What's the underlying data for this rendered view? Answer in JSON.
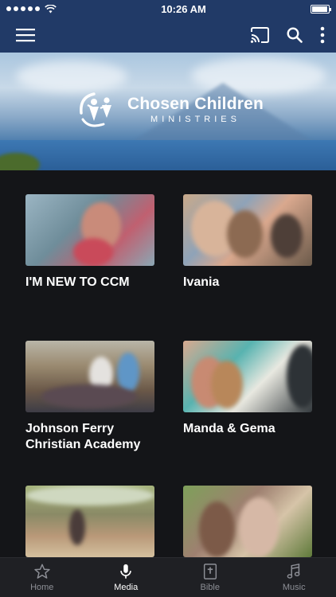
{
  "status_bar": {
    "time": "10:26 AM",
    "battery_level": 0.95
  },
  "app_bar": {
    "menu_icon": "hamburger-menu-icon",
    "cast_icon": "cast-icon",
    "search_icon": "search-icon",
    "more_icon": "more-vertical-icon"
  },
  "banner": {
    "logo_title": "Chosen Children",
    "logo_subtitle": "MINISTRIES"
  },
  "media_items": [
    {
      "title": "I'M NEW TO CCM"
    },
    {
      "title": "Ivania"
    },
    {
      "title": "Johnson Ferry Christian Academy"
    },
    {
      "title": "Manda & Gema"
    },
    {
      "title": ""
    },
    {
      "title": ""
    }
  ],
  "tab_bar": {
    "tabs": [
      {
        "label": "Home",
        "icon": "star-icon"
      },
      {
        "label": "Media",
        "icon": "microphone-icon"
      },
      {
        "label": "Bible",
        "icon": "bible-icon"
      },
      {
        "label": "Music",
        "icon": "music-note-icon"
      }
    ],
    "active": "Media"
  },
  "colors": {
    "primary": "#213a67",
    "background": "#141518",
    "tab_bar": "#1f2024",
    "inactive_tab": "#8d8f96"
  }
}
